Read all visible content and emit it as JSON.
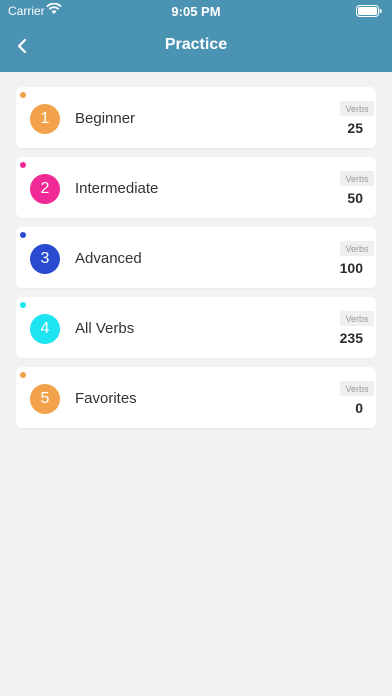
{
  "status_bar": {
    "carrier": "Carrier",
    "time": "9:05 PM"
  },
  "header": {
    "title": "Practice",
    "back_icon": "chevron-left-icon"
  },
  "verbs_label": "Verbs",
  "levels": [
    {
      "number": "1",
      "label": "Beginner",
      "count": "25",
      "color": "#f2a24a"
    },
    {
      "number": "2",
      "label": "Intermediate",
      "count": "50",
      "color": "#ef2a96"
    },
    {
      "number": "3",
      "label": "Advanced",
      "count": "100",
      "color": "#2a4bd0"
    },
    {
      "number": "4",
      "label": "All Verbs",
      "count": "235",
      "color": "#1ee3f0"
    },
    {
      "number": "5",
      "label": "Favorites",
      "count": "0",
      "color": "#f2a24a"
    }
  ]
}
